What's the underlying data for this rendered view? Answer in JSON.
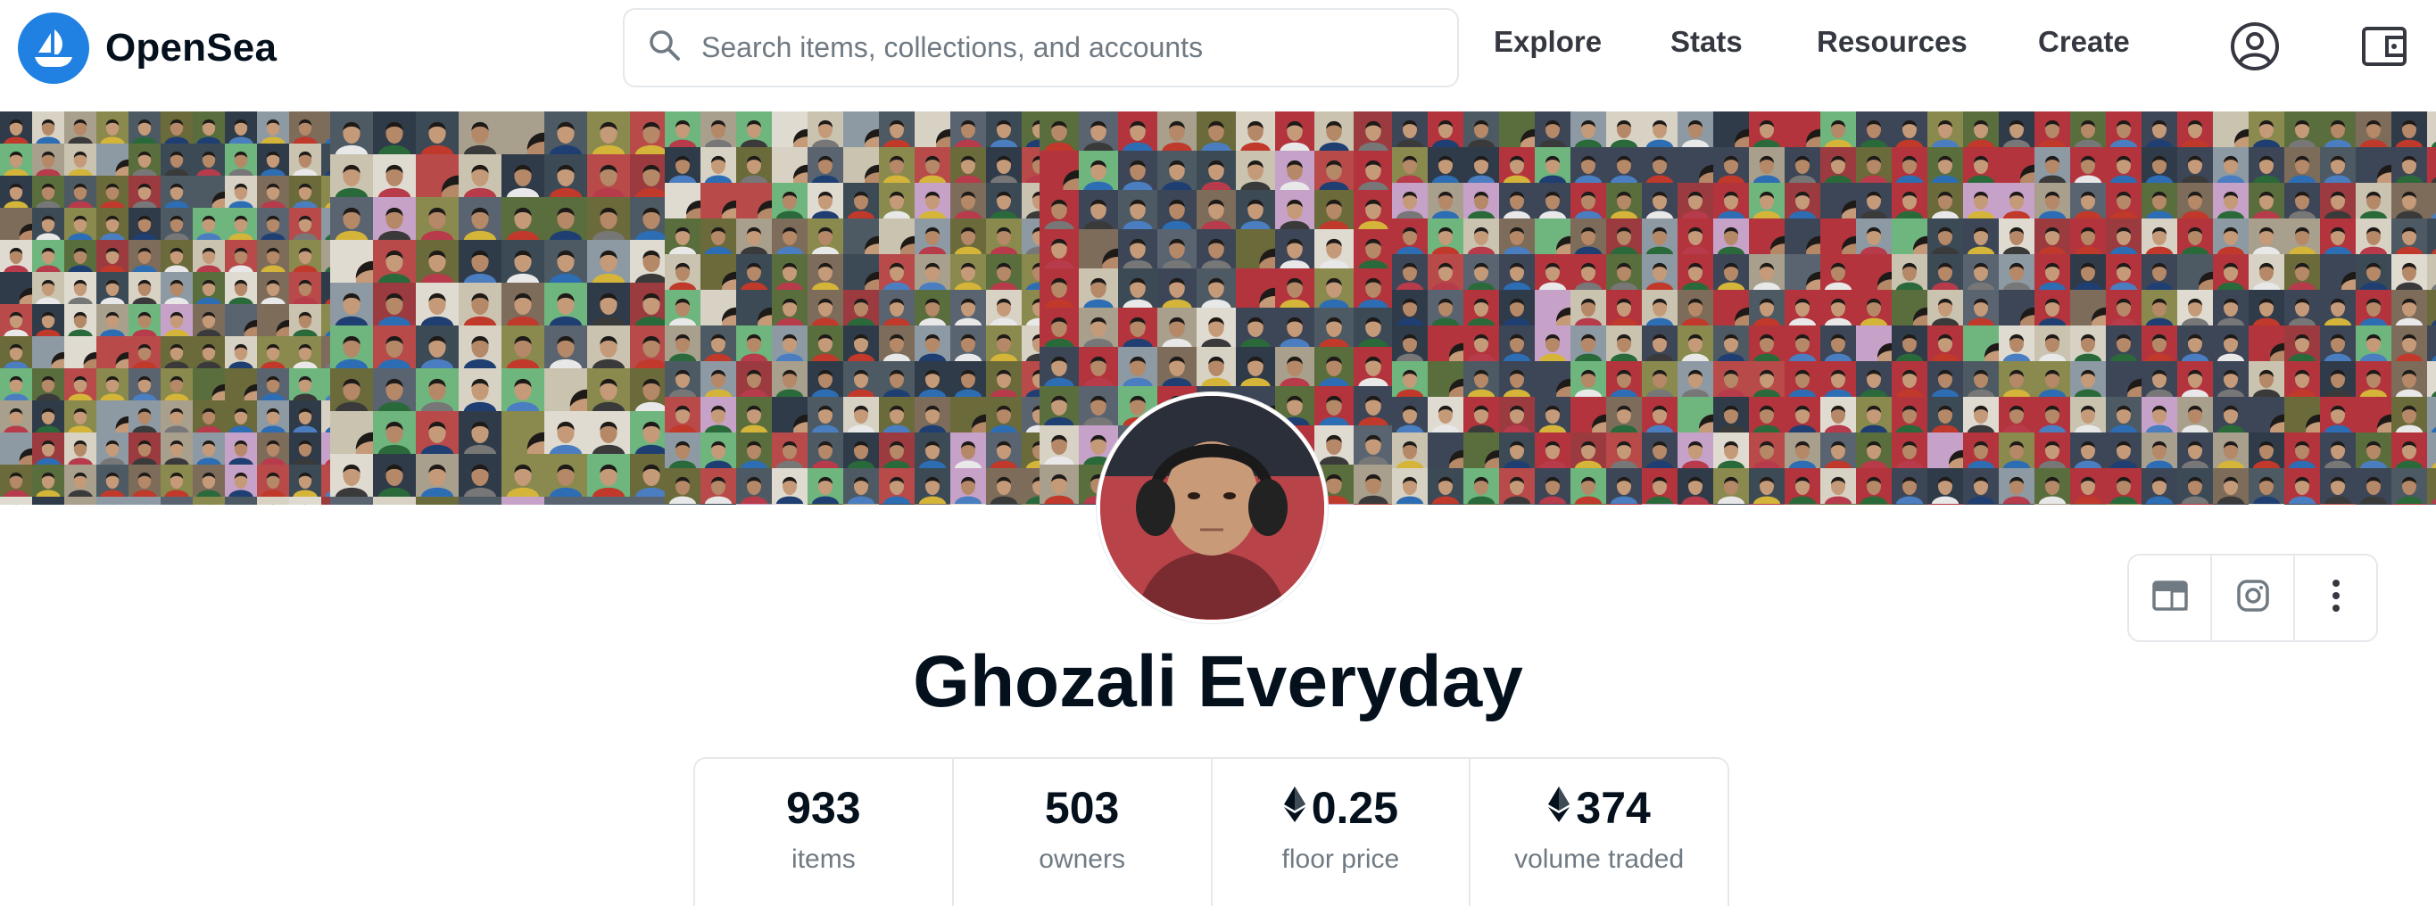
{
  "header": {
    "brand": "OpenSea",
    "search_placeholder": "Search items, collections, and accounts",
    "nav": {
      "explore": "Explore",
      "stats": "Stats",
      "resources": "Resources",
      "create": "Create"
    },
    "icons": [
      "opensea-logo-icon",
      "search-icon",
      "account-icon",
      "wallet-icon"
    ]
  },
  "collection": {
    "name": "Ghozali Everyday",
    "social_icons": [
      "website-icon",
      "instagram-icon",
      "more-options-icon"
    ],
    "stats": [
      {
        "value": "933",
        "label": "items",
        "eth": false
      },
      {
        "value": "503",
        "label": "owners",
        "eth": false
      },
      {
        "value": "0.25",
        "label": "floor price",
        "eth": true
      },
      {
        "value": "374",
        "label": "volume traded",
        "eth": true
      }
    ]
  },
  "colors": {
    "brand_blue": "#2081e2",
    "text_primary": "#04111d",
    "text_secondary": "#707a83",
    "border": "#e5e8eb"
  }
}
